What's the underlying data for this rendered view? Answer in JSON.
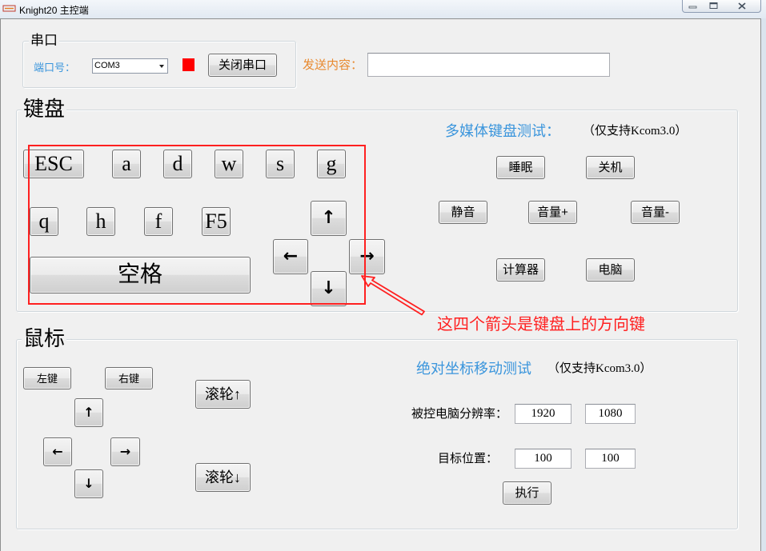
{
  "window": {
    "title": "Knight20 主控端",
    "icons": {
      "app": "app-icon",
      "minimize": "minimize-icon",
      "maximize": "maximize-icon",
      "close": "close-icon"
    }
  },
  "serial": {
    "group_label": "串口",
    "port_label": "端口号：",
    "port_value": "COM3",
    "status_color": "#ff0000",
    "close_button": "关闭串口"
  },
  "send": {
    "label": "发送内容："
  },
  "keyboard": {
    "group_label": "键盘",
    "keys": [
      "ESC",
      "a",
      "d",
      "w",
      "s",
      "g",
      "q",
      "h",
      "f",
      "F5"
    ],
    "space": "空格",
    "arrows": {
      "up": "↑",
      "left": "←",
      "right": "→",
      "down": "↓"
    }
  },
  "annotation": {
    "text": "这四个箭头是键盘上的方向键",
    "color": "#ff2020"
  },
  "multimedia": {
    "label": "多媒体键盘测试：",
    "note": "（仅支持Kcom3.0）",
    "buttons": {
      "sleep": "睡眠",
      "shutdown": "关机",
      "mute": "静音",
      "volume_up": "音量+",
      "volume_down": "音量-",
      "calculator": "计算器",
      "computer": "电脑"
    }
  },
  "mouse": {
    "group_label": "鼠标",
    "left_button": "左键",
    "right_button": "右键",
    "arrows": {
      "up": "↑",
      "left": "←",
      "right": "→",
      "down": "↓"
    },
    "wheel_up": "滚轮↑",
    "wheel_down": "滚轮↓"
  },
  "absolute_move": {
    "label": "绝对坐标移动测试",
    "note": "（仅支持Kcom3.0）",
    "resolution_label": "被控电脑分辨率：",
    "resolution_width": "1920",
    "resolution_height": "1080",
    "target_label": "目标位置：",
    "target_x": "100",
    "target_y": "100",
    "execute_button": "执行"
  },
  "colors": {
    "label_blue": "#3a95dc",
    "label_orange": "#e8892e",
    "window_bg": "#f0f0f0"
  }
}
